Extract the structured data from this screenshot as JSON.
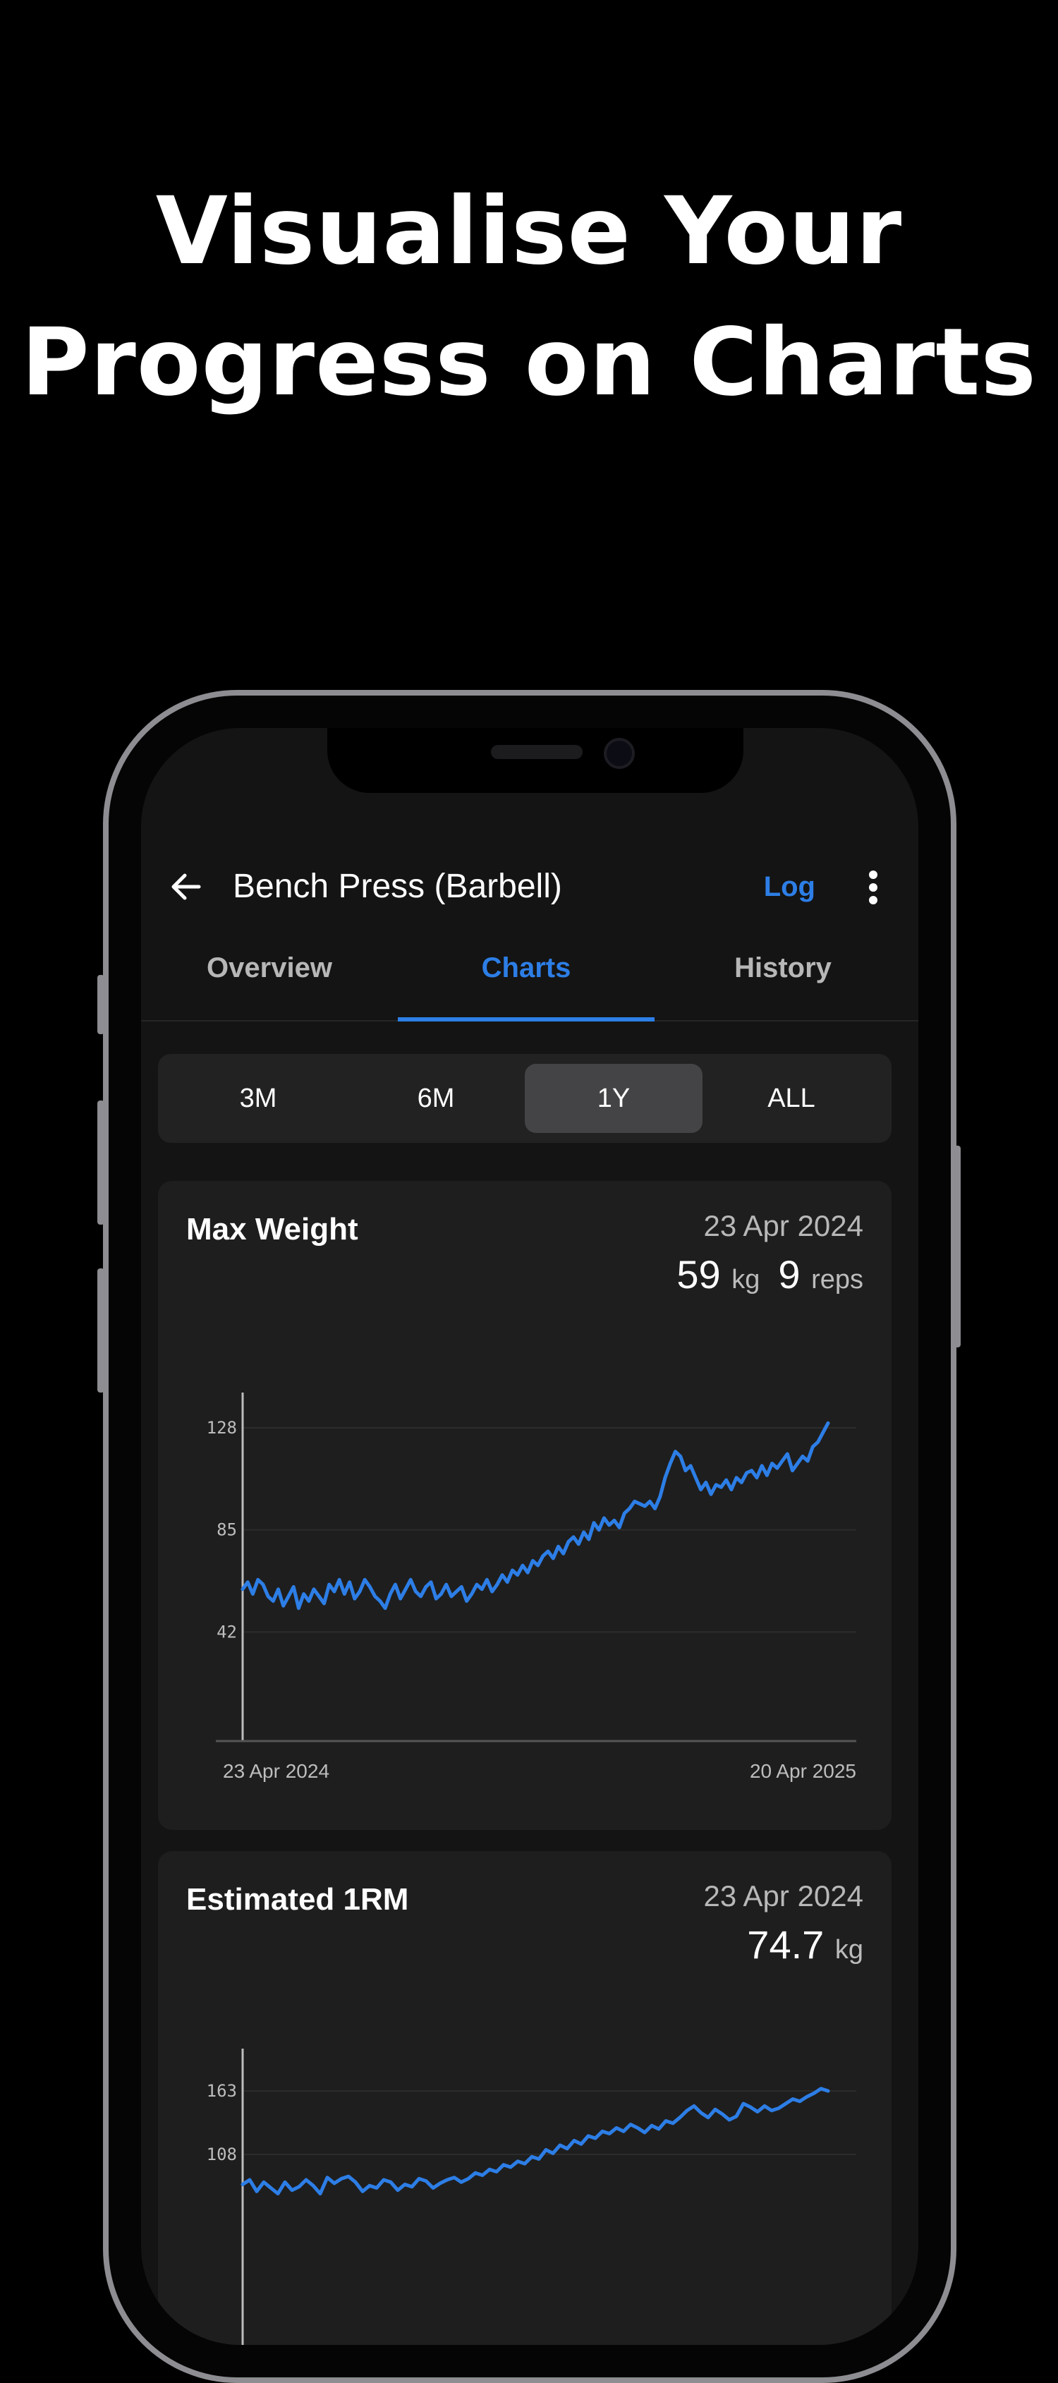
{
  "headline": {
    "line1": "Visualise Your",
    "line2": "Progress on Charts"
  },
  "header": {
    "title": "Bench Press (Barbell)",
    "log_label": "Log"
  },
  "tabs": [
    {
      "label": "Overview",
      "active": false
    },
    {
      "label": "Charts",
      "active": true
    },
    {
      "label": "History",
      "active": false
    }
  ],
  "ranges": [
    {
      "label": "3M",
      "active": false
    },
    {
      "label": "6M",
      "active": false
    },
    {
      "label": "1Y",
      "active": true
    },
    {
      "label": "ALL",
      "active": false
    }
  ],
  "colors": {
    "accent": "#2d7ee6",
    "background": "#000000",
    "card": "#1e1e1e"
  },
  "icons": {
    "back": "arrow-left-icon",
    "more": "more-vertical-icon"
  },
  "cards": [
    {
      "title": "Max Weight",
      "date": "23 Apr 2024",
      "value1": "59",
      "unit1": "kg",
      "value2": "9",
      "unit2": "reps"
    },
    {
      "title": "Estimated 1RM",
      "date": "23 Apr 2024",
      "value1": "74.7",
      "unit1": "kg"
    }
  ],
  "chart_data": [
    {
      "type": "line",
      "title": "Max Weight",
      "x_start_label": "23 Apr 2024",
      "x_end_label": "20 Apr 2025",
      "yticks": [
        128,
        85,
        42
      ],
      "ylim": [
        0,
        128
      ],
      "grid": true,
      "values": [
        60,
        63,
        58,
        64,
        62,
        57,
        55,
        60,
        53,
        57,
        61,
        52,
        58,
        55,
        60,
        57,
        54,
        62,
        59,
        64,
        58,
        63,
        56,
        59,
        64,
        61,
        57,
        55,
        52,
        58,
        62,
        56,
        60,
        64,
        59,
        57,
        61,
        63,
        56,
        58,
        62,
        57,
        59,
        61,
        55,
        58,
        62,
        60,
        64,
        59,
        62,
        66,
        63,
        68,
        66,
        70,
        67,
        72,
        70,
        74,
        76,
        73,
        78,
        75,
        80,
        82,
        79,
        84,
        81,
        88,
        85,
        90,
        87,
        89,
        86,
        92,
        94,
        97,
        96,
        95,
        97,
        94,
        99,
        107,
        113,
        118,
        116,
        110,
        112,
        107,
        102,
        105,
        100,
        104,
        103,
        106,
        102,
        107,
        105,
        109,
        110,
        107,
        112,
        108,
        113,
        111,
        114,
        117,
        110,
        113,
        116,
        114,
        120,
        122,
        126,
        130
      ]
    },
    {
      "type": "line",
      "title": "Estimated 1RM",
      "yticks": [
        163,
        108
      ],
      "grid": true,
      "values": [
        82,
        86,
        76,
        84,
        79,
        74,
        84,
        77,
        80,
        86,
        81,
        74,
        88,
        83,
        87,
        89,
        84,
        76,
        81,
        79,
        86,
        84,
        77,
        82,
        80,
        87,
        85,
        79,
        83,
        86,
        88,
        84,
        87,
        92,
        90,
        95,
        93,
        99,
        97,
        102,
        100,
        106,
        104,
        112,
        109,
        116,
        113,
        120,
        117,
        124,
        122,
        128,
        126,
        131,
        128,
        134,
        131,
        127,
        133,
        130,
        137,
        135,
        140,
        146,
        150,
        144,
        140,
        147,
        143,
        138,
        141,
        152,
        149,
        145,
        150,
        146,
        148,
        152,
        156,
        154,
        158,
        161,
        165,
        163
      ]
    }
  ]
}
